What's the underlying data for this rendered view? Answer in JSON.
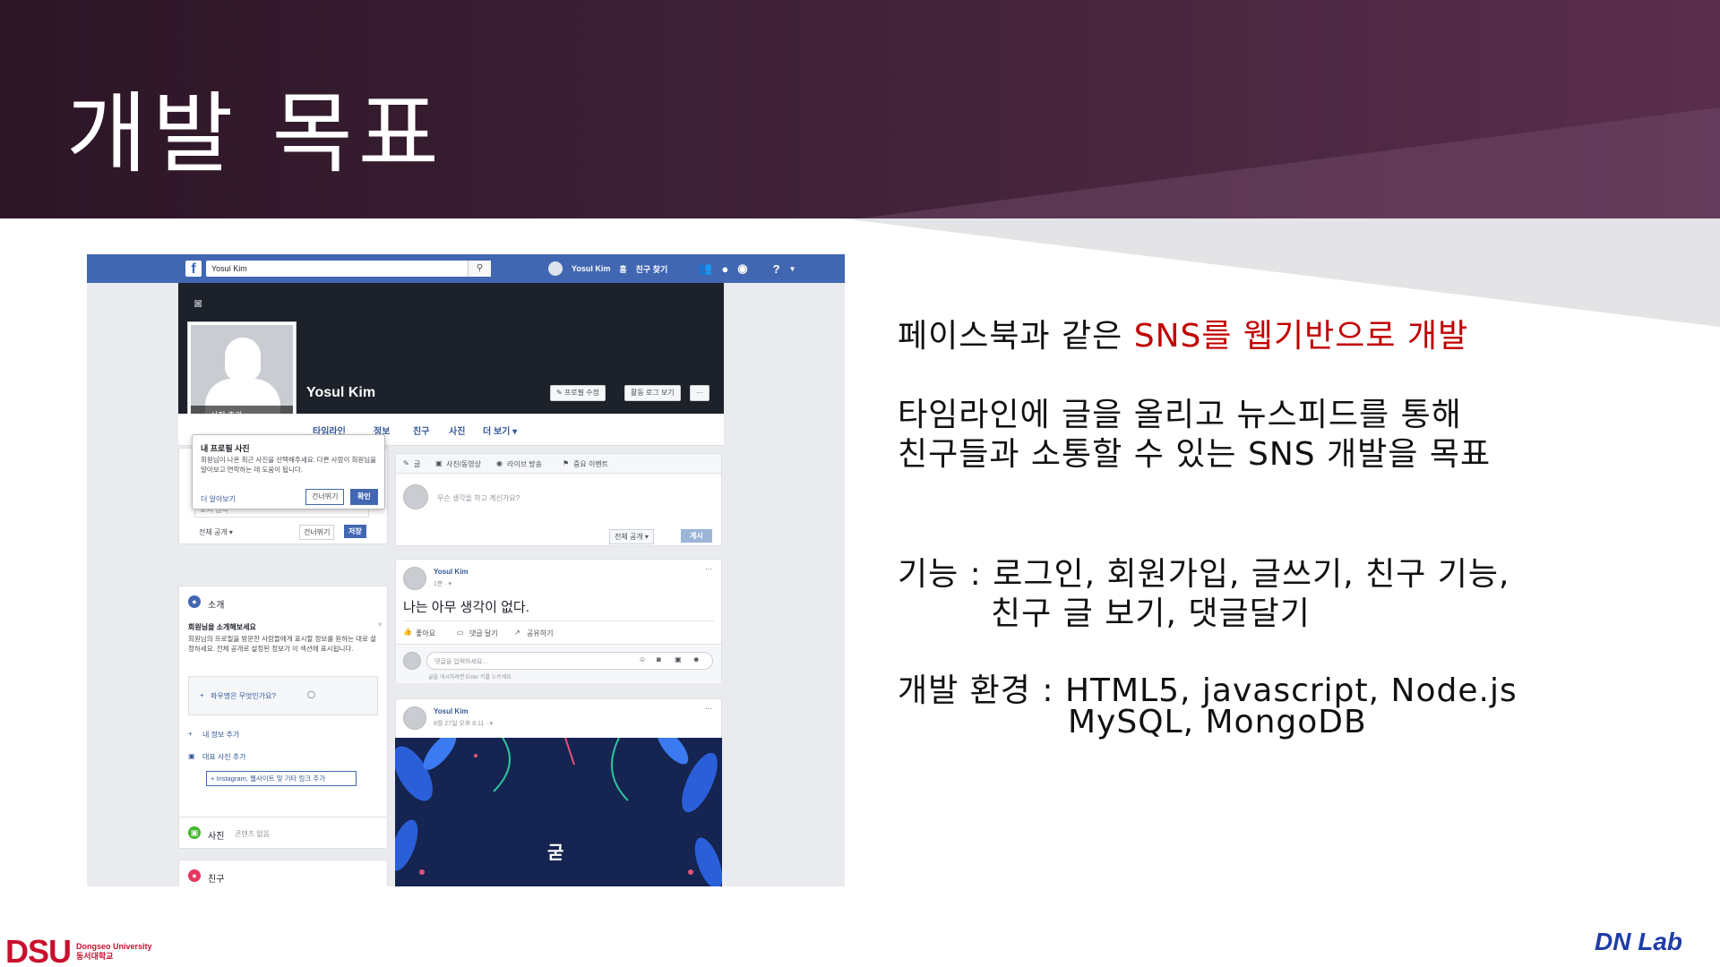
{
  "slide": {
    "title": "개발 목표",
    "line1_black": "페이스북과 같은 ",
    "line1_red": "SNS를 웹기반으로 개발",
    "line2": "타임라인에 글을 올리고 뉴스피드를 통해",
    "line3": "친구들과 소통할 수 있는 SNS 개발을 목표",
    "line4": "기능 : 로그인, 회원가입, 글쓰기, 친구 기능,",
    "line5": "친구 글 보기, 댓글달기",
    "line6": "개발 환경 : HTML5, javascript, Node.js",
    "line7": "MySQL, MongoDB",
    "footer_logo": "DSU",
    "footer_uni_en": "Dongseo University",
    "footer_uni_ko": "동서대학교",
    "footer_right": "DN Lab",
    "accent_red": "#c00000",
    "header_color": "#3e2136"
  },
  "fb": {
    "logo": "f",
    "search_value": "Yosul Kim",
    "nav_user": "Yosul Kim",
    "nav_home": "홈",
    "nav_find_friends": "친구 찾기",
    "profile_name": "Yosul Kim",
    "add_photo": "사진 추가",
    "btn_edit_profile": "✎ 프로필 수정",
    "btn_activity_log": "활동 로그 보기",
    "btn_more": "···",
    "tabs": [
      "타임라인",
      "정보",
      "친구",
      "사진",
      "더 보기 ▾"
    ],
    "popup": {
      "title": "내 프로필 사진",
      "text": "회원님이 나온 최근 사진을 선택해주세요. 다른 사람이 회원님을 알아보고 연락하는 데 도움이 됩니다.",
      "link": "더 알아보기",
      "skip": "건너뛰기",
      "ok": "확인"
    },
    "city_placeholder": "도시 입력",
    "privacy_public": "전체 공개 ▾",
    "skip": "건너뛰기",
    "save": "저장",
    "intro": {
      "title": "소개",
      "heading": "회원님을 소개해보세요",
      "text": "회원님의 프로필을 방문한 사람들에게 표시할 정보를 원하는 대로 설정하세요. 전체 공개로 설정된 정보가 이 섹션에 표시됩니다.",
      "motto": "좌우명은 무엇인가요?",
      "add_info": "내 정보 추가",
      "add_photos": "대표 사진 추가",
      "add_links": "Instagram, 웹사이트 및 기타 링크 추가"
    },
    "photos": {
      "title": "사진",
      "empty": "콘텐츠 없음"
    },
    "friends": {
      "title": "친구"
    },
    "composer": {
      "tab_post": "글",
      "tab_photo": "사진/동영상",
      "tab_live": "라이브 방송",
      "tab_event": "중요 이벤트",
      "placeholder": "무슨 생각을 하고 계신가요?",
      "privacy": "전체 공개 ▾",
      "post": "게시"
    },
    "post1": {
      "author": "Yosul Kim",
      "time": "1분 · ▾",
      "text": "나는 아무 생각이 없다.",
      "like": "좋아요",
      "comment": "댓글 달기",
      "share": "공유하기",
      "comment_placeholder": "댓글을 입력하세요...",
      "enter_hint": "글을 게시하려면 Enter 키를 누르세요."
    },
    "post2": {
      "author": "Yosul Kim",
      "time": "8월 27일 오후 8:11 · ▾",
      "image_text": "굳"
    }
  }
}
